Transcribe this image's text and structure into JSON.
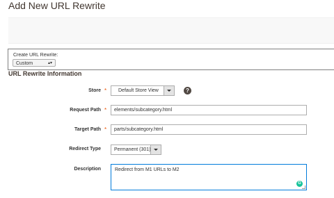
{
  "page": {
    "title": "Add New URL Rewrite"
  },
  "create": {
    "label": "Create URL Rewrite:",
    "selected": "Custom"
  },
  "section": {
    "title": "URL Rewrite Information"
  },
  "fields": {
    "store": {
      "label": "Store",
      "value": "Default Store View"
    },
    "request_path": {
      "label": "Request Path",
      "value": "elements/subcategory.html"
    },
    "target_path": {
      "label": "Target Path",
      "value": "parts/subcategory.html"
    },
    "redirect_type": {
      "label": "Redirect Type",
      "value": "Permanent (301)"
    },
    "description": {
      "label": "Description",
      "value": "Redirect from M1 URLs to M2"
    }
  },
  "required_marker": "*",
  "icons": {
    "help": "help-icon",
    "grammarly": "grammarly-icon"
  },
  "colors": {
    "required": "#eb5202",
    "focus_border": "#007bdb",
    "grammarly": "#15c39a"
  }
}
